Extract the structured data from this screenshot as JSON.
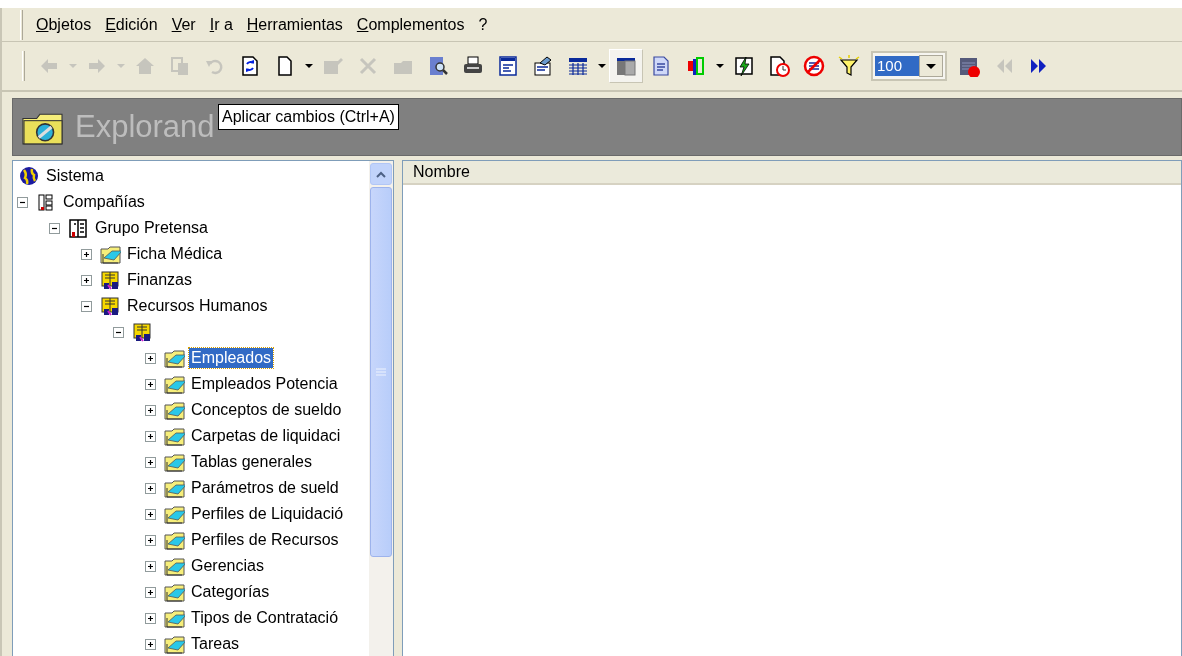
{
  "menu": [
    {
      "label": "Objetos"
    },
    {
      "label": "Edición"
    },
    {
      "label": "Ver"
    },
    {
      "label": "Ir a"
    },
    {
      "label": "Herramientas"
    },
    {
      "label": "Complementos"
    },
    {
      "label": "?"
    }
  ],
  "toolbar": [
    {
      "kind": "back",
      "disabled": true,
      "pressed": false
    },
    {
      "kind": "dropdown",
      "disabled": true
    },
    {
      "kind": "forward",
      "disabled": true,
      "pressed": false
    },
    {
      "kind": "dropdown",
      "disabled": true
    },
    {
      "kind": "home",
      "disabled": true,
      "pressed": false
    },
    {
      "kind": "copy",
      "disabled": true,
      "pressed": false
    },
    {
      "kind": "undo",
      "disabled": true,
      "pressed": false
    },
    {
      "kind": "apply",
      "disabled": false,
      "pressed": false
    },
    {
      "kind": "new",
      "disabled": false,
      "pressed": false
    },
    {
      "kind": "dropdown",
      "disabled": false
    },
    {
      "kind": "edit",
      "disabled": true,
      "pressed": false
    },
    {
      "kind": "delete",
      "disabled": true,
      "pressed": false
    },
    {
      "kind": "move",
      "disabled": true,
      "pressed": false
    },
    {
      "kind": "find",
      "disabled": false,
      "pressed": false
    },
    {
      "kind": "print",
      "disabled": false,
      "pressed": false
    },
    {
      "kind": "form",
      "disabled": false,
      "pressed": false
    },
    {
      "kind": "properties",
      "disabled": false,
      "pressed": false
    },
    {
      "kind": "grid",
      "disabled": false,
      "pressed": false
    },
    {
      "kind": "dropdown",
      "disabled": false
    },
    {
      "kind": "layout",
      "disabled": false,
      "pressed": true
    },
    {
      "kind": "report",
      "disabled": false,
      "pressed": false
    },
    {
      "kind": "chart",
      "disabled": false,
      "pressed": false
    },
    {
      "kind": "dropdown",
      "disabled": false
    },
    {
      "kind": "flash",
      "disabled": false,
      "pressed": false
    },
    {
      "kind": "schedule",
      "disabled": false,
      "pressed": false
    },
    {
      "kind": "block",
      "disabled": false,
      "pressed": false
    },
    {
      "kind": "filter",
      "disabled": false,
      "pressed": false
    },
    {
      "kind": "zoom",
      "value": "100"
    },
    {
      "kind": "calendar",
      "disabled": false,
      "pressed": false
    },
    {
      "kind": "previous",
      "disabled": true,
      "pressed": false
    },
    {
      "kind": "next",
      "disabled": false,
      "pressed": false
    }
  ],
  "tooltip": "Aplicar cambios (Ctrl+A)",
  "header": {
    "title": "Explorand"
  },
  "tree": [
    {
      "label": "Sistema",
      "kind": "globe",
      "children": [
        {
          "label": "Compañías",
          "kind": "company",
          "expanded": true,
          "selected": false,
          "children": [
            {
              "label": "Grupo Pretensa",
              "kind": "group",
              "expanded": true,
              "selected": false,
              "children": [
                {
                  "label": "Ficha Médica",
                  "kind": "folder",
                  "expanded": false,
                  "selected": false
                },
                {
                  "label": "Finanzas",
                  "kind": "module",
                  "expanded": false,
                  "selected": false
                },
                {
                  "label": "Recursos Humanos",
                  "kind": "module",
                  "expanded": true,
                  "selected": false,
                  "children": [
                    {
                      "kind": "module",
                      "expanded": true,
                      "selected": false,
                      "children": [
                        {
                          "label": "Empleados",
                          "kind": "folder",
                          "expanded": false,
                          "selected": true
                        },
                        {
                          "label": "Empleados Potencia",
                          "kind": "folder",
                          "expanded": false,
                          "selected": false
                        },
                        {
                          "label": "Conceptos de sueldo",
                          "kind": "folder",
                          "expanded": false,
                          "selected": false
                        },
                        {
                          "label": "Carpetas de liquidaci",
                          "kind": "folder",
                          "expanded": false,
                          "selected": false
                        },
                        {
                          "label": "Tablas generales",
                          "kind": "folder",
                          "expanded": false,
                          "selected": false
                        },
                        {
                          "label": "Parámetros de sueld",
                          "kind": "folder",
                          "expanded": false,
                          "selected": false
                        },
                        {
                          "label": "Perfiles de Liquidació",
                          "kind": "folder",
                          "expanded": false,
                          "selected": false
                        },
                        {
                          "label": "Perfiles de Recursos",
                          "kind": "folder",
                          "expanded": false,
                          "selected": false
                        },
                        {
                          "label": "Gerencias",
                          "kind": "folder",
                          "expanded": false,
                          "selected": false
                        },
                        {
                          "label": "Categorías",
                          "kind": "folder",
                          "expanded": false,
                          "selected": false
                        },
                        {
                          "label": "Tipos de Contratació",
                          "kind": "folder",
                          "expanded": false,
                          "selected": false
                        },
                        {
                          "label": "Tareas",
                          "kind": "folder",
                          "expanded": false,
                          "selected": false
                        }
                      ]
                    }
                  ]
                }
              ]
            }
          ]
        }
      ]
    }
  ],
  "list": {
    "columns": [
      "Nombre"
    ]
  }
}
